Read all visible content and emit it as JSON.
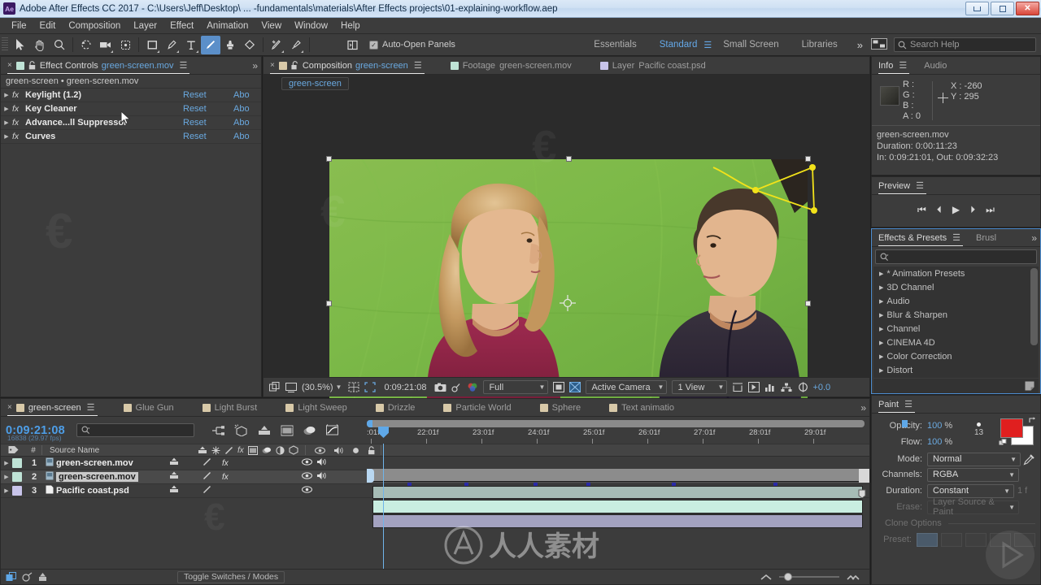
{
  "window": {
    "title": "Adobe After Effects CC 2017 - C:\\Users\\Jeff\\Desktop\\ ... -fundamentals\\materials\\After Effects projects\\01-explaining-workflow.aep",
    "app_badge": "Ae",
    "minimize": "–",
    "maximize": "❐",
    "close": "✕"
  },
  "menu": {
    "items": [
      "File",
      "Edit",
      "Composition",
      "Layer",
      "Effect",
      "Animation",
      "View",
      "Window",
      "Help"
    ]
  },
  "toolbar": {
    "tools": [
      {
        "name": "selection-tool",
        "glyph": "▶",
        "active": false
      },
      {
        "name": "hand-tool",
        "glyph": "✋",
        "active": false
      },
      {
        "name": "zoom-tool",
        "glyph": "○",
        "active": false
      },
      {
        "name": "rotation-tool",
        "glyph": "↺",
        "active": false
      },
      {
        "name": "camera-tool",
        "glyph": "▬",
        "active": false
      },
      {
        "name": "pan-behind-tool",
        "glyph": "⧉",
        "active": false
      },
      {
        "name": "shape-tool",
        "glyph": "□",
        "active": false
      },
      {
        "name": "pen-tool",
        "glyph": "✒",
        "active": false
      },
      {
        "name": "text-tool",
        "glyph": "T",
        "active": false
      },
      {
        "name": "brush-tool",
        "glyph": "╱",
        "active": true
      },
      {
        "name": "clone-stamp-tool",
        "glyph": "⚓",
        "active": false
      },
      {
        "name": "eraser-tool",
        "glyph": "◆",
        "active": false
      },
      {
        "name": "roto-brush-tool",
        "glyph": "⚘",
        "active": false
      },
      {
        "name": "puppet-pin-tool",
        "glyph": "✒",
        "active": false
      }
    ],
    "auto_open_panels": "Auto-Open Panels",
    "workspaces": [
      {
        "label": "Essentials",
        "selected": false
      },
      {
        "label": "Standard",
        "selected": true
      },
      {
        "label": "Small Screen",
        "selected": false
      },
      {
        "label": "Libraries",
        "selected": false
      }
    ],
    "overflow": "»",
    "search_help_placeholder": "Search Help"
  },
  "effect_controls": {
    "tabs": [
      {
        "label": "Effect Controls",
        "linked": "green-screen.mov",
        "active": true,
        "swatch": "#bfe3d6",
        "locked": true
      }
    ],
    "breadcrumb": "green-screen • green-screen.mov",
    "col_reset": "Reset",
    "col_about": "Abo",
    "effects": [
      {
        "name": "Keylight (1.2)",
        "reset": "Reset",
        "about": "Abo"
      },
      {
        "name": "Key Cleaner",
        "reset": "Reset",
        "about": "Abo"
      },
      {
        "name": "Advance...ll Suppressor",
        "reset": "Reset",
        "about": "Abo"
      },
      {
        "name": "Curves",
        "reset": "Reset",
        "about": "Abo"
      }
    ]
  },
  "composition": {
    "tabs": [
      {
        "prefix": "Composition",
        "label": "green-screen",
        "active": true,
        "swatch": "#d8c9a8"
      },
      {
        "prefix": "Footage",
        "label": "green-screen.mov",
        "active": false,
        "swatch": "#bfe3d6"
      },
      {
        "prefix": "Layer",
        "label": "Pacific coast.psd",
        "active": false,
        "swatch": "#c8c4ea"
      }
    ],
    "mini_flowchart_label": "green-screen",
    "bottom_bar": {
      "magnification": "(30.5%)",
      "timecode": "0:09:21:08",
      "resolution": "Full",
      "view_camera": "Active Camera",
      "views": "1 View",
      "exposure": "+0.0"
    }
  },
  "info": {
    "tabs": [
      {
        "label": "Info",
        "active": true
      },
      {
        "label": "Audio",
        "active": false
      }
    ],
    "channels": [
      "R :",
      "G :",
      "B :",
      "A : 0"
    ],
    "x_label": "X : -260",
    "y_label": "Y : 295",
    "file_name": "green-screen.mov",
    "duration": "Duration: 0:00:11:23",
    "in_out": "In: 0:09:21:01, Out: 0:09:32:23"
  },
  "preview": {
    "tabs": [
      {
        "label": "Preview",
        "active": true
      }
    ],
    "buttons": [
      {
        "name": "first-frame-button",
        "glyph": "⏮"
      },
      {
        "name": "previous-frame-button",
        "glyph": "⏴"
      },
      {
        "name": "play-button",
        "glyph": "▶"
      },
      {
        "name": "next-frame-button",
        "glyph": "⏵"
      },
      {
        "name": "last-frame-button",
        "glyph": "⏭"
      }
    ]
  },
  "effects_presets": {
    "tabs": [
      {
        "label": "Effects & Presets",
        "active": true
      },
      {
        "label": "Brusl",
        "active": false
      }
    ],
    "overflow": "»",
    "search_placeholder": "",
    "categories": [
      "* Animation Presets",
      "3D Channel",
      "Audio",
      "Blur & Sharpen",
      "Channel",
      "CINEMA 4D",
      "Color Correction",
      "Distort"
    ]
  },
  "paint": {
    "tabs": [
      {
        "label": "Paint",
        "active": true
      }
    ],
    "opacity_label": "Opacity:",
    "opacity_value": "100",
    "opacity_unit": "%",
    "flow_label": "Flow:",
    "flow_value": "100",
    "flow_unit": "%",
    "brush_size": "13",
    "foreground_color": "#e01f1f",
    "background_color": "#ffffff",
    "mode_label": "Mode:",
    "mode_value": "Normal",
    "channels_label": "Channels:",
    "channels_value": "RGBA",
    "duration_label": "Duration:",
    "duration_value": "Constant",
    "duration_frames": "1 f",
    "erase_label": "Erase:",
    "erase_value": "Layer Source & Paint",
    "clone_options_label": "Clone Options",
    "preset_label": "Preset:"
  },
  "timeline": {
    "tabs": [
      {
        "label": "green-screen",
        "active": true,
        "swatch": "#d8c9a8"
      },
      {
        "label": "Glue Gun",
        "active": false,
        "swatch": "#d8c9a8"
      },
      {
        "label": "Light Burst",
        "active": false,
        "swatch": "#d8c9a8"
      },
      {
        "label": "Light Sweep",
        "active": false,
        "swatch": "#d8c9a8"
      },
      {
        "label": "Drizzle",
        "active": false,
        "swatch": "#d8c9a8"
      },
      {
        "label": "Particle World",
        "active": false,
        "swatch": "#d8c9a8"
      },
      {
        "label": "Sphere",
        "active": false,
        "swatch": "#d8c9a8"
      },
      {
        "label": "Text animatio",
        "active": false,
        "swatch": "#d8c9a8"
      }
    ],
    "overflow": "»",
    "current_time": "0:09:21:08",
    "frame_info": "16838 (29.97 fps)",
    "search_placeholder": "",
    "columns": {
      "tag": "◩",
      "number": "#",
      "source_name": "Source Name"
    },
    "layers": [
      {
        "index": "1",
        "name": "green-screen.mov",
        "swatch": "#bfe3d6",
        "selected": false,
        "has_fx": true,
        "audio": true,
        "visible": true,
        "bar_color": "#a6bcb6"
      },
      {
        "index": "2",
        "name": "green-screen.mov",
        "swatch": "#bfe3d6",
        "selected": true,
        "has_fx": true,
        "audio": true,
        "visible": true,
        "bar_color": "#bfe8dd"
      },
      {
        "index": "3",
        "name": "Pacific coast.psd",
        "swatch": "#c8c4ea",
        "selected": false,
        "has_fx": false,
        "audio": false,
        "visible": true,
        "bar_color": "#a3a2c0"
      }
    ],
    "ruler_labels": [
      ":01f",
      "22:01f",
      "23:01f",
      "24:01f",
      "25:01f",
      "26:01f",
      "27:01f",
      "28:01f",
      "29:01f"
    ],
    "toggle_switches": "Toggle Switches / Modes"
  },
  "watermark": {
    "text": "人人素材"
  }
}
